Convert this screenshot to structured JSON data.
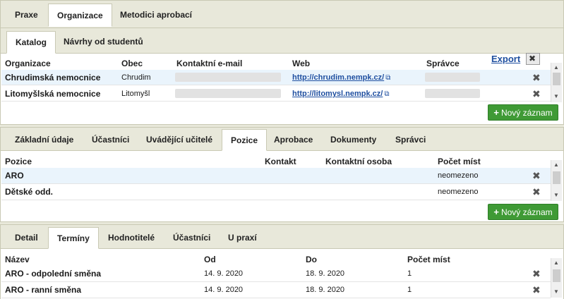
{
  "main_tabs": [
    "Praxe",
    "Organizace",
    "Metodici aprobací"
  ],
  "catalog_tabs": [
    "Katalog",
    "Návrhy od studentů"
  ],
  "export_label": "Export",
  "org_table": {
    "headers": [
      "Organizace",
      "Obec",
      "Kontaktní e-mail",
      "Web",
      "Správce"
    ],
    "rows": [
      {
        "org": "Chrudimská nemocnice",
        "obec": "Chrudim",
        "web": "http://chrudim.nempk.cz/"
      },
      {
        "org": "Litomyšlská nemocnice",
        "obec": "Litomyšl",
        "web": "http://litomysl.nempk.cz/"
      }
    ]
  },
  "new_record_label": "Nový záznam",
  "org_detail_tabs": [
    "Základní údaje",
    "Účastníci",
    "Uvádějící učitelé",
    "Pozice",
    "Aprobace",
    "Dokumenty",
    "Správci"
  ],
  "positions_table": {
    "headers": [
      "Pozice",
      "Kontakt",
      "Kontaktní osoba",
      "Počet míst"
    ],
    "rows": [
      {
        "pozice": "ARO",
        "pocet": "neomezeno"
      },
      {
        "pozice": "Dětské odd.",
        "pocet": "neomezeno"
      }
    ]
  },
  "position_detail_tabs": [
    "Detail",
    "Termíny",
    "Hodnotitelé",
    "Účastníci",
    "U praxí"
  ],
  "terms_table": {
    "headers": [
      "Název",
      "Od",
      "Do",
      "Počet míst"
    ],
    "rows": [
      {
        "nazev": "ARO - odpolední směna",
        "od": "14. 9. 2020",
        "do": "18. 9. 2020",
        "pocet": "1"
      },
      {
        "nazev": "ARO - ranní směna",
        "od": "14. 9. 2020",
        "do": "18. 9. 2020",
        "pocet": "1"
      }
    ]
  },
  "icons": {
    "delete": "close-icon",
    "external": "external-link-icon",
    "excel": "excel-export-icon",
    "add": "plus-icon"
  }
}
